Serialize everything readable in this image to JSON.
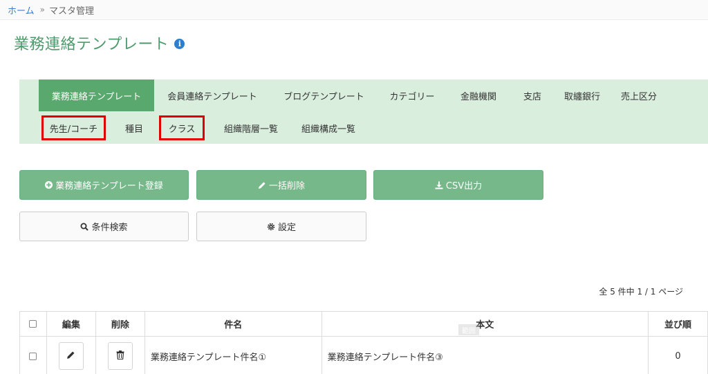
{
  "breadcrumb": {
    "home": "ホーム",
    "separator": "»",
    "current": "マスタ管理"
  },
  "page": {
    "title": "業務連絡テンプレート",
    "info_icon": "info-icon"
  },
  "tabs_row1": [
    {
      "label": "業務連絡テンプレート",
      "active": true
    },
    {
      "label": "会員連絡テンプレート"
    },
    {
      "label": "ブログテンプレート"
    },
    {
      "label": "カテゴリー"
    },
    {
      "label": "金融機関"
    },
    {
      "label": "支店"
    },
    {
      "label": "取纏銀行"
    },
    {
      "label": "売上区分"
    }
  ],
  "tabs_row2": [
    {
      "label": "先生/コーチ",
      "highlighted": true
    },
    {
      "label": "種目"
    },
    {
      "label": "クラス",
      "highlighted": true
    },
    {
      "label": "組織階層一覧"
    },
    {
      "label": "組織構成一覧"
    }
  ],
  "actions": {
    "register": "業務連絡テンプレート登録",
    "bulk_delete": "一括削除",
    "csv_export": "CSV出力",
    "search": "条件検索",
    "settings": "設定"
  },
  "pager": {
    "text": "全 5 件中 1 / 1 ページ"
  },
  "table": {
    "headers": {
      "edit": "編集",
      "delete": "削除",
      "subject": "件名",
      "body": "本文",
      "order": "並び順"
    },
    "rows": [
      {
        "subject": "業務連絡テンプレート件名①",
        "body": "業務連絡テンプレート件名③",
        "order": "0"
      }
    ]
  },
  "watermark": "範囲",
  "colors": {
    "accent_green": "#59a86e",
    "tab_bg": "#d9eedd",
    "button_green": "#76b88a",
    "title_green": "#4e9a6c",
    "highlight_red": "#e00000",
    "link_blue": "#3a7bd5"
  }
}
